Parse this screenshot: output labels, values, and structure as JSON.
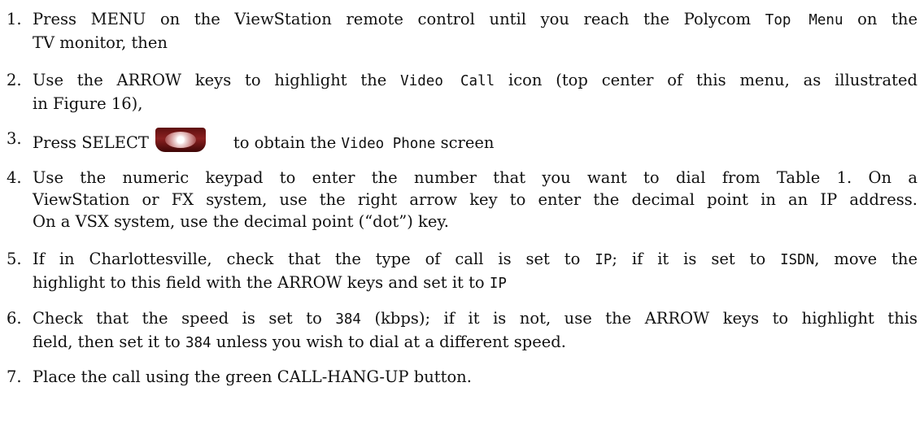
{
  "steps": [
    {
      "number": "1.",
      "lines": [
        {
          "a": "Press MENU on the ViewStation remote control until you reach the Polycom ",
          "code": "Top Menu",
          "b": " on the"
        },
        {
          "a": "TV monitor, then"
        }
      ]
    },
    {
      "number": "2.",
      "lines": [
        {
          "a": "Use the ARROW keys to highlight the ",
          "code": "Video Call",
          "b": " icon (top center of this menu, as illustrated"
        },
        {
          "a": "in Figure 16),"
        }
      ]
    },
    {
      "number": "3.",
      "lines": [
        {
          "a": "Press SELECT",
          "b": "to obtain the ",
          "code": "Video Phone",
          "c": " screen",
          "icon": "select-button-icon"
        }
      ]
    },
    {
      "number": "4.",
      "lines": [
        {
          "a": "Use the numeric keypad to enter the number that you want to dial from Table 1.  On a"
        },
        {
          "a": "ViewStation or FX system, use the right arrow key to enter the decimal point in an IP address."
        },
        {
          "a": "On a VSX system, use the decimal point (“dot”) key."
        }
      ]
    },
    {
      "number": "5.",
      "lines": [
        {
          "a": "If in Charlottesville, check that the type of call is set to ",
          "code": "IP",
          "b": "; if it is set to ",
          "code2": "ISDN",
          "c": ", move the"
        },
        {
          "a": "highlight to this field with the ARROW keys and set it to ",
          "code": "IP"
        }
      ]
    },
    {
      "number": "6.",
      "lines": [
        {
          "a": "Check that the speed is set to ",
          "code": "384",
          "b": " (kbps); if it is not, use the ARROW keys to highlight this"
        },
        {
          "a": "field, then set it to ",
          "code": "384",
          "b": " unless you wish to dial at a different speed."
        }
      ]
    },
    {
      "number": "7.",
      "lines": [
        {
          "a": "Place the call using the green CALL-HANG-UP button."
        }
      ]
    }
  ]
}
